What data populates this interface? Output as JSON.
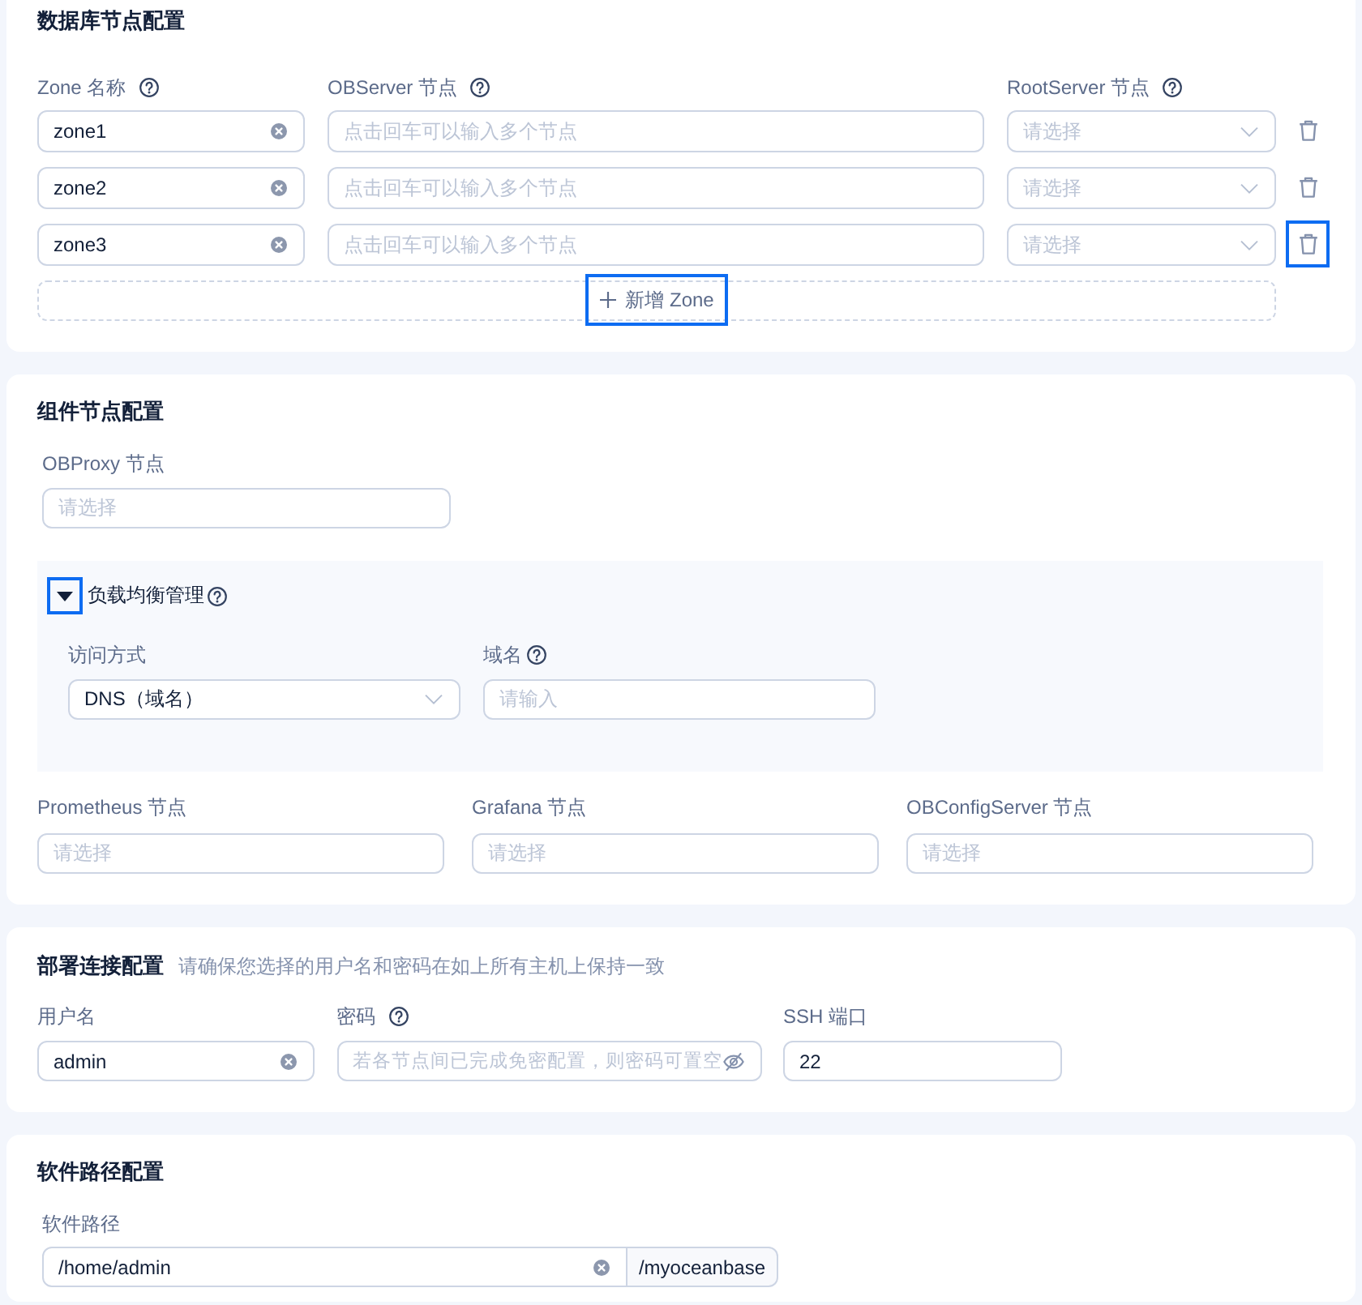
{
  "database_nodes": {
    "title": "数据库节点配置",
    "columns": [
      {
        "label": "Zone 名称",
        "help": true
      },
      {
        "label": "OBServer 节点",
        "help": true
      },
      {
        "label": "RootServer 节点",
        "help": true
      }
    ],
    "zones": [
      {
        "zone_name": {
          "kind": "input",
          "value": "zone1",
          "clearable": true
        },
        "observer_nodes": {
          "kind": "input",
          "placeholder": "点击回车可以输入多个节点"
        },
        "rootserver_node": {
          "kind": "select",
          "placeholder": "请选择"
        },
        "delete_focused": false
      },
      {
        "zone_name": {
          "kind": "input",
          "value": "zone2",
          "clearable": true
        },
        "observer_nodes": {
          "kind": "input",
          "placeholder": "点击回车可以输入多个节点"
        },
        "rootserver_node": {
          "kind": "select",
          "placeholder": "请选择"
        },
        "delete_focused": false
      },
      {
        "zone_name": {
          "kind": "input",
          "value": "zone3",
          "clearable": true
        },
        "observer_nodes": {
          "kind": "input",
          "placeholder": "点击回车可以输入多个节点"
        },
        "rootserver_node": {
          "kind": "select",
          "placeholder": "请选择"
        },
        "delete_focused": true
      }
    ],
    "add_zone": {
      "label": "新增 Zone",
      "focused": true
    }
  },
  "component_nodes": {
    "title": "组件节点配置",
    "obproxy": {
      "label": "OBProxy 节点",
      "help": false,
      "field": {
        "kind": "multi_select",
        "placeholder": "请选择"
      }
    },
    "load_balancing": {
      "title": "负载均衡管理",
      "help": true,
      "expanded": true,
      "toggle_focused": true,
      "fields": [
        {
          "label": "访问方式",
          "help": false,
          "field": {
            "kind": "select",
            "value": "DNS（域名）"
          }
        },
        {
          "label": "域名",
          "help": true,
          "field": {
            "kind": "input",
            "placeholder": "请输入"
          }
        }
      ]
    },
    "monitoring": [
      {
        "label": "Prometheus 节点",
        "help": false,
        "field": {
          "kind": "multi_select",
          "placeholder": "请选择"
        }
      },
      {
        "label": "Grafana 节点",
        "help": false,
        "field": {
          "kind": "multi_select",
          "placeholder": "请选择"
        }
      },
      {
        "label": "OBConfigServer 节点",
        "help": false,
        "field": {
          "kind": "multi_select",
          "placeholder": "请选择"
        }
      }
    ]
  },
  "connection": {
    "title": "部署连接配置",
    "hint": "请确保您选择的用户名和密码在如上所有主机上保持一致",
    "fields": [
      {
        "label": "用户名",
        "help": false,
        "field": {
          "kind": "input",
          "value": "admin",
          "clearable": true
        }
      },
      {
        "label": "密码",
        "help": true,
        "field": {
          "kind": "password",
          "placeholder": "若各节点间已完成免密配置，则密码可置空",
          "visible": false
        }
      },
      {
        "label": "SSH 端口",
        "help": false,
        "field": {
          "kind": "input",
          "value": "22",
          "clearable": false
        }
      }
    ]
  },
  "software_path": {
    "title": "软件路径配置",
    "label": "软件路径",
    "help": false,
    "field": {
      "kind": "input",
      "value": "/home/admin",
      "clearable": true,
      "suffix": "/myoceanbase"
    }
  }
}
